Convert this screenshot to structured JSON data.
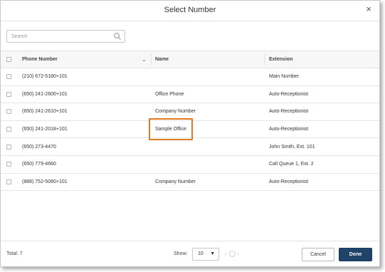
{
  "dialog": {
    "title": "Select Number",
    "close_glyph": "×"
  },
  "search": {
    "placeholder": "Search",
    "value": ""
  },
  "table": {
    "columns": {
      "phone": "Phone Number",
      "name": "Name",
      "extension": "Extension"
    },
    "rows": [
      {
        "phone": "(210) 672-5180+101",
        "name": "",
        "extension": "Main Number"
      },
      {
        "phone": "(650) 241-2600+101",
        "name": "Office Phone",
        "extension": "Auto-Receptionist"
      },
      {
        "phone": "(650) 241-2610+101",
        "name": "Company Number",
        "extension": "Auto-Receptionist"
      },
      {
        "phone": "(650) 241-2018+101",
        "name": "Sample Office",
        "extension": "Auto-Receptionist"
      },
      {
        "phone": "(650) 273-4470",
        "name": "",
        "extension": "John Smith, Ext. 101"
      },
      {
        "phone": "(650) 779-4660",
        "name": "",
        "extension": "Call Queue 1, Ext. 2"
      },
      {
        "phone": "(888) 752-5060+101",
        "name": "Company Number",
        "extension": "Auto-Receptionist"
      }
    ]
  },
  "footer": {
    "total": "Total: 7",
    "show_label": "Show:",
    "page_size": "10",
    "cancel_label": "Cancel",
    "done_label": "Done"
  },
  "colors": {
    "highlight": "#e07b1f",
    "primary_button": "#1f4369"
  }
}
